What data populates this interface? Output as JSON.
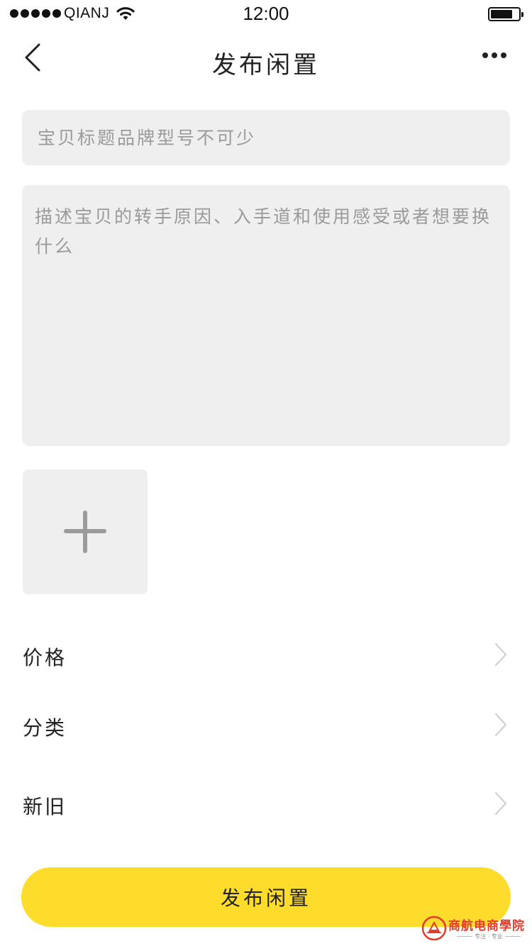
{
  "status_bar": {
    "carrier": "QIANJ",
    "time": "12:00"
  },
  "nav": {
    "title": "发布闲置",
    "back_icon": "chevron-left-icon",
    "more_icon": "more-dots-icon"
  },
  "form": {
    "title_placeholder": "宝贝标题品牌型号不可少",
    "title_value": "",
    "description_placeholder": "描述宝贝的转手原因、入手道和使用感受或者想要换什么",
    "description_value": "",
    "add_photo_icon": "plus-icon",
    "rows": [
      {
        "label": "价格",
        "icon": "chevron-right-icon"
      },
      {
        "label": "分类",
        "icon": "chevron-right-icon"
      },
      {
        "label": "新旧",
        "icon": "chevron-right-icon"
      }
    ]
  },
  "submit": {
    "label": "发布闲置"
  },
  "watermark": {
    "text": "商航电商學院",
    "subtext": "专注 · 专业"
  },
  "colors": {
    "accent": "#fddc2c",
    "input_bg": "#efefef",
    "placeholder": "#9a9a9a",
    "text": "#222222",
    "chevron": "#cccccc"
  }
}
